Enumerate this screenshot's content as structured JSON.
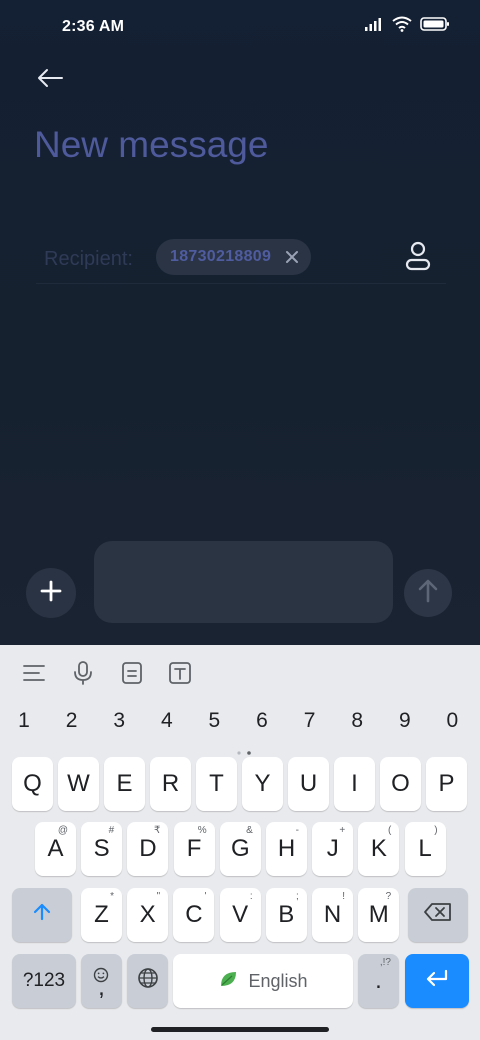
{
  "status": {
    "time": "2:36 AM",
    "icons": [
      "signal-icon",
      "wifi-icon",
      "battery-icon"
    ]
  },
  "header": {
    "back_icon": "arrow-left-icon",
    "title": "New message"
  },
  "recipient": {
    "label": "Recipient:",
    "chips": [
      {
        "value": "18730218809"
      }
    ],
    "contact_icon": "person-icon"
  },
  "compose": {
    "add_icon": "plus-icon",
    "text_value": "",
    "send_icon": "arrow-up-icon"
  },
  "keyboard": {
    "toolbar": [
      "menu-lines-icon",
      "microphone-icon",
      "clipboard-icon",
      "text-format-icon"
    ],
    "numbers": [
      "1",
      "2",
      "3",
      "4",
      "5",
      "6",
      "7",
      "8",
      "9",
      "0"
    ],
    "row1": [
      {
        "k": "Q"
      },
      {
        "k": "W"
      },
      {
        "k": "E"
      },
      {
        "k": "R"
      },
      {
        "k": "T"
      },
      {
        "k": "Y"
      },
      {
        "k": "U"
      },
      {
        "k": "I"
      },
      {
        "k": "O"
      },
      {
        "k": "P"
      }
    ],
    "row2": [
      {
        "k": "A",
        "h": "@"
      },
      {
        "k": "S",
        "h": "#"
      },
      {
        "k": "D",
        "h": "₹"
      },
      {
        "k": "F",
        "h": "%"
      },
      {
        "k": "G",
        "h": "&"
      },
      {
        "k": "H",
        "h": "-"
      },
      {
        "k": "J",
        "h": "+"
      },
      {
        "k": "K",
        "h": "("
      },
      {
        "k": "L",
        "h": ")"
      }
    ],
    "row3": [
      {
        "k": "Z",
        "h": "*"
      },
      {
        "k": "X",
        "h": "\""
      },
      {
        "k": "C",
        "h": "'"
      },
      {
        "k": "V",
        "h": ":"
      },
      {
        "k": "B",
        "h": ";"
      },
      {
        "k": "N",
        "h": "!"
      },
      {
        "k": "M",
        "h": "?"
      }
    ],
    "symbols_label": "?123",
    "comma_label": ",",
    "space_label": "English",
    "period_label": ".",
    "period_hint": ",!?",
    "shift_icon": "shift-arrow-icon",
    "backspace_icon": "backspace-icon",
    "globe_icon": "globe-icon",
    "emoji_icon": "emoji-icon",
    "leaf_icon": "leaf-icon",
    "enter_icon": "enter-icon"
  },
  "colors": {
    "app_bg": "#142033",
    "title": "#4e5a9b",
    "chip_text": "#4f5c9f",
    "accent_blue": "#1a8cff",
    "keyboard_bg": "#e8eaed"
  }
}
